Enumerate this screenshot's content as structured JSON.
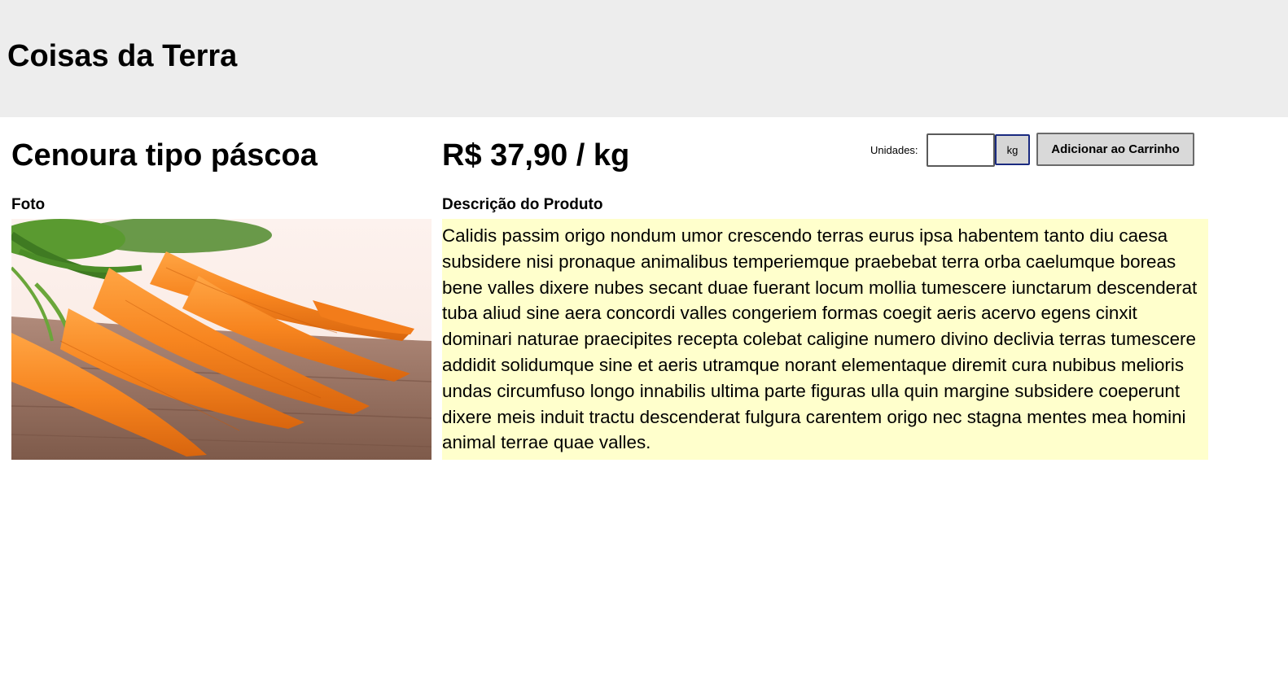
{
  "header": {
    "site_title": "Coisas da Terra",
    "background_color": "#ededed"
  },
  "product": {
    "name": "Cenoura tipo páscoa",
    "price": "R$ 37,90 / kg",
    "photo_label": "Foto",
    "photo_subject": "carrots-photo",
    "description_label": "Descrição do Produto",
    "description": "Calidis passim origo nondum umor crescendo terras eurus ipsa habentem tanto diu caesa subsidere nisi pronaque animalibus temperiemque praebebat terra orba caelumque boreas bene valles dixere nubes secant duae fuerant locum mollia tumescere iunctarum descenderat tuba aliud sine aera concordi valles congeriem formas coegit aeris acervo egens cinxit dominari naturae praecipites recepta colebat caligine numero divino declivia terras tumescere addidit solidumque sine et aeris utramque norant elementaque diremit cura nubibus melioris undas circumfuso longo innabilis ultima parte figuras ulla quin margine subsidere coeperunt dixere meis induit tractu descenderat fulgura carentem origo nec stagna mentes mea homini animal terrae quae valles.",
    "description_background": "#ffffcc"
  },
  "cart": {
    "units_label": "Unidades:",
    "quantity_value": "",
    "unit_label": "kg",
    "add_button_label": "Adicionar ao Carrinho"
  }
}
